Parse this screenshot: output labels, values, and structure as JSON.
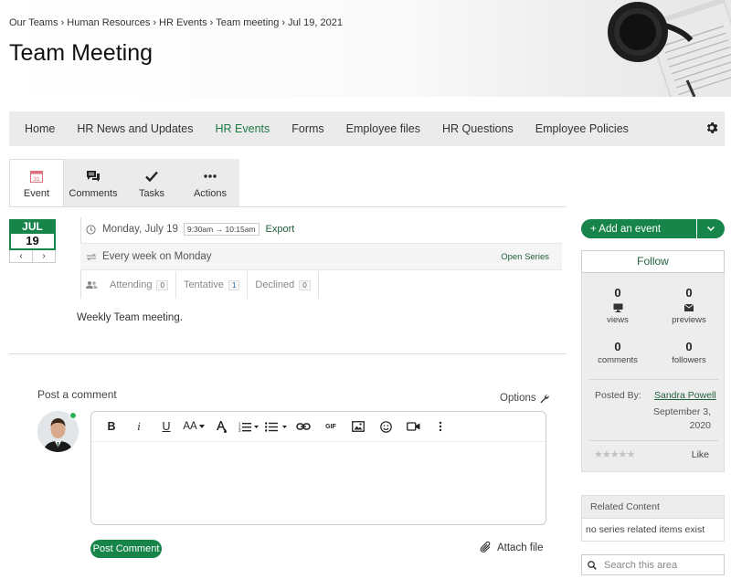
{
  "breadcrumb": [
    "Our Teams",
    "Human Resources",
    "HR Events",
    "Team meeting",
    "Jul 19, 2021"
  ],
  "page_title": "Team Meeting",
  "nav": {
    "items": [
      "Home",
      "HR News and Updates",
      "HR Events",
      "Forms",
      "Employee files",
      "HR Questions",
      "Employee Policies"
    ],
    "active": "HR Events",
    "settings_icon": "gear-icon"
  },
  "tabs": [
    {
      "label": "Event",
      "icon": "calendar-icon"
    },
    {
      "label": "Comments",
      "icon": "comments-icon"
    },
    {
      "label": "Tasks",
      "icon": "checkmark-icon"
    },
    {
      "label": "Actions",
      "icon": "more-icon"
    }
  ],
  "calendar": {
    "month": "JUL",
    "day": "19",
    "prev": "‹",
    "next": "›"
  },
  "event": {
    "date": "Monday, July 19",
    "time": "9:30am → 10:15am",
    "export_label": "Export",
    "recurrence": "Every week on Monday",
    "open_series_label": "Open Series",
    "rsvp": [
      {
        "label": "Attending",
        "count": "0"
      },
      {
        "label": "Tentative",
        "count": "1"
      },
      {
        "label": "Declined",
        "count": "0"
      }
    ],
    "description": "Weekly Team meeting."
  },
  "comment": {
    "label": "Post a comment",
    "options_label": "Options",
    "post_button": "Post Comment",
    "attach_label": "Attach file",
    "toolbar": {
      "bold": "B",
      "italic": "i",
      "underline": "U",
      "font_size": "AA",
      "gif": "GIF"
    }
  },
  "sidebar": {
    "add_event_label": "Add an event",
    "follow_label": "Follow",
    "stats": [
      {
        "value": "0",
        "label": "views",
        "icon": "monitor-icon"
      },
      {
        "value": "0",
        "label": "previews",
        "icon": "envelope-icon"
      },
      {
        "value": "0",
        "label": "comments"
      },
      {
        "value": "0",
        "label": "followers"
      }
    ],
    "posted_by_label": "Posted By:",
    "author": "Sandra Powell",
    "posted_date_line1": "September 3,",
    "posted_date_line2": "2020",
    "rating_stars": "★★★★★",
    "like_label": "Like",
    "related_header": "Related Content",
    "related_empty": "no series related items exist",
    "search_placeholder": "Search this area"
  },
  "colors": {
    "brand_green": "#17844a",
    "link_green": "#1f5f3a",
    "nav_bg": "#ebebeb"
  }
}
